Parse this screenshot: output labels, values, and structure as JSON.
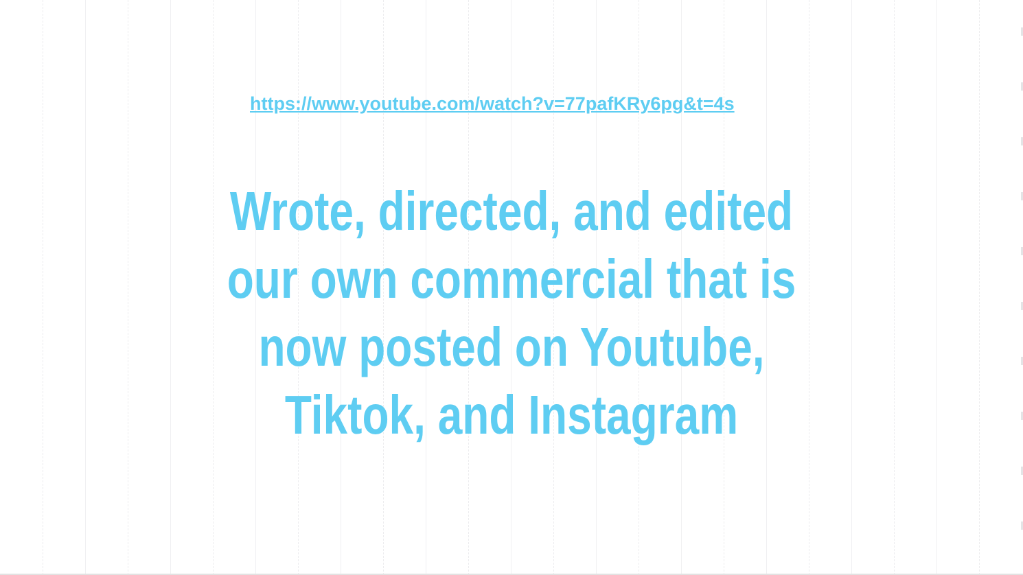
{
  "slide": {
    "link_text": "https://www.youtube.com/watch?v=77pafKRy6pg&t=4s",
    "headline": "Wrote, directed, and edited our own commercial that is now posted on Youtube, Tiktok, and Instagram"
  },
  "colors": {
    "accent": "#5ecdf2",
    "background": "#ffffff"
  }
}
